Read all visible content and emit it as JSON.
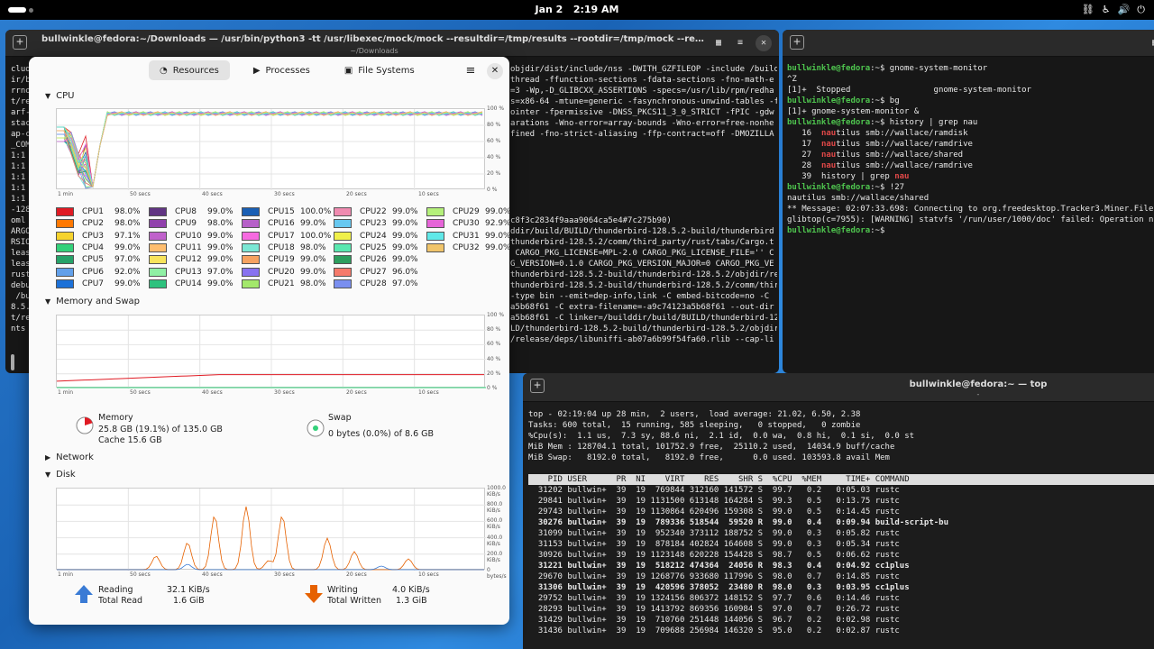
{
  "topbar": {
    "date": "Jan 2",
    "time": "2:19 AM"
  },
  "terminal_left": {
    "title": "bullwinkle@fedora:~/Downloads — /usr/bin/python3 -tt /usr/libexec/mock/mock --resultdir=/tmp/results --rootdir=/tmp/mock --rebuild thunderbird-128.5.2-1....",
    "subtitle": "~/Downloads",
    "left_lines": [
      "clud",
      "ir/b",
      "rrno",
      "t/re",
      "arf-",
      "stac",
      "ap-c",
      "_COM",
      "1:1",
      "1:1",
      "1:1",
      "1:1",
      "1:1",
      "-128",
      "oml",
      "ARGO",
      "RSIO",
      "leas",
      "leas",
      "rust",
      "debu",
      " /bu",
      "8.5.",
      "t/re",
      "nts"
    ],
    "right_lines": [
      "objdir/dist/include/nss -DWITH_GZFILEOP -include /buildd",
      "thread -ffunction-sections -fdata-sections -fno-math-e",
      "=3 -Wp,-D_GLIBCXX_ASSERTIONS -specs=/usr/lib/rpm/redha",
      "s=x86-64 -mtune=generic -fasynchronous-unwind-tables -f",
      "ointer -fpermissive -DNSS_PKCS11_3_0_STRICT -fPIC -gdw",
      "arations -Wno-error=array-bounds -Wno-error=free-nonhe",
      "fined -fno-strict-aliasing -ffp-contract=off -DMOZILLA",
      "",
      "",
      "",
      "",
      "",
      "",
      "",
      "c8f3c2834f9aaa9064ca5e4#7c275b90)",
      "ddir/build/BUILD/thunderbird-128.5.2-build/thunderbird",
      "thunderbird-128.5.2/comm/third_party/rust/tabs/Cargo.t",
      " CARGO_PKG_LICENSE=MPL-2.0 CARGO_PKG_LICENSE_FILE='' C",
      "G_VERSION=0.1.0 CARGO_PKG_VERSION_MAJOR=0 CARGO_PKG_VE",
      "thunderbird-128.5.2-build/thunderbird-128.5.2/objdir/re",
      "thunderbird-128.5.2-build/thunderbird-128.5.2/comm/third_party/",
      "-type bin --emit=dep-info,link -C embed-bitcode=no -C",
      "a5b68f61 -C extra-filename=-a9c74123a5b68f61 --out-dir",
      "a5b68f61 -C linker=/builddir/build/BUILD/thunderbird-12",
      "LD/thunderbird-128.5.2-build/thunderbird-128.5.2/objdir",
      "/release/deps/libuniffi-ab07a6b99f54fa60.rlib --cap-li"
    ]
  },
  "terminal_right": {
    "lines": [
      {
        "p": "bullwinkle@fedora",
        "t": ":~$ gnome-system-monitor"
      },
      {
        "t": "^Z"
      },
      {
        "t": "[1]+  Stopped                 gnome-system-monitor"
      },
      {
        "p": "bullwinkle@fedora",
        "t": ":~$ bg"
      },
      {
        "t": "[1]+ gnome-system-monitor &"
      },
      {
        "p": "bullwinkle@fedora",
        "t": ":~$ history | grep nau"
      },
      {
        "n": "   16  ",
        "r": "nau",
        "t": "tilus smb://wallace/ramdisk"
      },
      {
        "n": "   17  ",
        "r": "nau",
        "t": "tilus smb://wallace/ramdrive"
      },
      {
        "n": "   27  ",
        "r": "nau",
        "t": "tilus smb://wallace/shared"
      },
      {
        "n": "   28  ",
        "r": "nau",
        "t": "tilus smb://wallace/ramdrive"
      },
      {
        "n": "   39  ",
        "t": "history | grep ",
        "r2": "nau"
      },
      {
        "p": "bullwinkle@fedora",
        "t": ":~$ !27"
      },
      {
        "t": "nautilus smb://wallace/shared"
      },
      {
        "t": "** Message: 02:07:33.698: Connecting to org.freedesktop.Tracker3.Miner.Files"
      },
      {
        "t": "glibtop(c=7955): [WARNING] statvfs '/run/user/1000/doc' failed: Operation not"
      },
      {
        "p": "bullwinkle@fedora",
        "t": ":~$ "
      }
    ]
  },
  "top": {
    "title": "bullwinkle@fedora:~ — top",
    "summary": [
      "top - 02:19:04 up 28 min,  2 users,  load average: 21.02, 6.50, 2.38",
      "Tasks: 600 total,  15 running, 585 sleeping,   0 stopped,   0 zombie",
      "%Cpu(s):  1.1 us,  7.3 sy, 88.6 ni,  2.1 id,  0.0 wa,  0.8 hi,  0.1 si,  0.0 st",
      "MiB Mem : 128704.1 total, 101752.9 free,  25110.2 used,  14034.9 buff/cache",
      "MiB Swap:   8192.0 total,   8192.0 free,      0.0 used. 103593.8 avail Mem"
    ],
    "header": "    PID USER      PR  NI    VIRT    RES    SHR S  %CPU  %MEM     TIME+ COMMAND",
    "rows": [
      {
        "t": "  31202 bullwin+  39  19  769844 312160 141572 S  99.7   0.2   0:05.03 rustc",
        "b": false
      },
      {
        "t": "  29841 bullwin+  39  19 1131500 613148 164284 S  99.3   0.5   0:13.75 rustc",
        "b": false
      },
      {
        "t": "  29743 bullwin+  39  19 1130864 620496 159308 S  99.0   0.5   0:14.45 rustc",
        "b": false
      },
      {
        "t": "  30276 bullwin+  39  19  789336 518544  59520 R  99.0   0.4   0:09.94 build-script-bu",
        "b": true
      },
      {
        "t": "  31099 bullwin+  39  19  952340 373112 188752 S  99.0   0.3   0:05.82 rustc",
        "b": false
      },
      {
        "t": "  31153 bullwin+  39  19  878184 402824 164608 S  99.0   0.3   0:05.34 rustc",
        "b": false
      },
      {
        "t": "  30926 bullwin+  39  19 1123148 620228 154428 S  98.7   0.5   0:06.62 rustc",
        "b": false
      },
      {
        "t": "  31221 bullwin+  39  19  518212 474364  24056 R  98.3   0.4   0:04.92 cc1plus",
        "b": true
      },
      {
        "t": "  29670 bullwin+  39  19 1268776 933680 117996 S  98.0   0.7   0:14.85 rustc",
        "b": false
      },
      {
        "t": "  31306 bullwin+  39  19  420596 378052  23480 R  98.0   0.3   0:03.95 cc1plus",
        "b": true
      },
      {
        "t": "  29752 bullwin+  39  19 1324156 806372 148152 S  97.7   0.6   0:14.46 rustc",
        "b": false
      },
      {
        "t": "  28293 bullwin+  39  19 1413792 869356 160984 S  97.0   0.7   0:26.72 rustc",
        "b": false
      },
      {
        "t": "  31429 bullwin+  39  19  710760 251448 144056 S  96.7   0.2   0:02.98 rustc",
        "b": false
      },
      {
        "t": "  31436 bullwin+  39  19  709688 256984 146320 S  95.0   0.2   0:02.87 rustc",
        "b": false
      }
    ]
  },
  "sysmon": {
    "tabs": [
      "Resources",
      "Processes",
      "File Systems"
    ],
    "sections": {
      "cpu": "CPU",
      "mem": "Memory and Swap",
      "net": "Network",
      "disk": "Disk"
    },
    "time_labels": [
      "1 min",
      "50 secs",
      "40 secs",
      "30 secs",
      "20 secs",
      "10 secs"
    ],
    "pct_labels": [
      "100 %",
      "80 %",
      "60 %",
      "40 %",
      "20 %",
      "0 %"
    ],
    "disk_labels": [
      "1000.0 KiB/s",
      "800.0 KiB/s",
      "600.0 KiB/s",
      "400.0 KiB/s",
      "200.0 KiB/s",
      "0 bytes/s"
    ],
    "cpus": [
      {
        "n": "CPU1",
        "v": "98.0%",
        "c": "#e01b24"
      },
      {
        "n": "CPU2",
        "v": "98.0%",
        "c": "#ff7800"
      },
      {
        "n": "CPU3",
        "v": "97.1%",
        "c": "#f6d32d"
      },
      {
        "n": "CPU4",
        "v": "99.0%",
        "c": "#33d17a"
      },
      {
        "n": "CPU5",
        "v": "97.0%",
        "c": "#26a269"
      },
      {
        "n": "CPU6",
        "v": "92.0%",
        "c": "#62a0ea"
      },
      {
        "n": "CPU7",
        "v": "99.0%",
        "c": "#1c71d8"
      },
      {
        "n": "CPU8",
        "v": "99.0%",
        "c": "#613583"
      },
      {
        "n": "CPU9",
        "v": "98.0%",
        "c": "#9141ac"
      },
      {
        "n": "CPU10",
        "v": "99.0%",
        "c": "#c061cb"
      },
      {
        "n": "CPU11",
        "v": "99.0%",
        "c": "#ffbe6f"
      },
      {
        "n": "CPU12",
        "v": "99.0%",
        "c": "#f8e45c"
      },
      {
        "n": "CPU13",
        "v": "97.0%",
        "c": "#8ff0a4"
      },
      {
        "n": "CPU14",
        "v": "99.0%",
        "c": "#2ec27e"
      },
      {
        "n": "CPU15",
        "v": "100.0%",
        "c": "#1a5fb4"
      },
      {
        "n": "CPU16",
        "v": "99.0%",
        "c": "#b660c8"
      },
      {
        "n": "CPU17",
        "v": "100.0%",
        "c": "#f66ae0"
      },
      {
        "n": "CPU18",
        "v": "98.0%",
        "c": "#7be7d4"
      },
      {
        "n": "CPU19",
        "v": "99.0%",
        "c": "#f5a261"
      },
      {
        "n": "CPU20",
        "v": "99.0%",
        "c": "#8872f0"
      },
      {
        "n": "CPU21",
        "v": "98.0%",
        "c": "#a3e86b"
      },
      {
        "n": "CPU22",
        "v": "99.0%",
        "c": "#f08bb0"
      },
      {
        "n": "CPU23",
        "v": "99.0%",
        "c": "#67c8f0"
      },
      {
        "n": "CPU24",
        "v": "99.0%",
        "c": "#f0f04a"
      },
      {
        "n": "CPU25",
        "v": "99.0%",
        "c": "#5ae8b0"
      },
      {
        "n": "CPU26",
        "v": "99.0%",
        "c": "#2e9e5e"
      },
      {
        "n": "CPU27",
        "v": "96.0%",
        "c": "#f57a6a"
      },
      {
        "n": "CPU28",
        "v": "97.0%",
        "c": "#7a8ff0"
      },
      {
        "n": "CPU29",
        "v": "99.0%",
        "c": "#b4f07a"
      },
      {
        "n": "CPU30",
        "v": "92.9%",
        "c": "#e664d8"
      },
      {
        "n": "CPU31",
        "v": "99.0%",
        "c": "#60e8e8"
      },
      {
        "n": "CPU32",
        "v": "99.0%",
        "c": "#f0c46a"
      }
    ],
    "memory": {
      "label": "Memory",
      "value": "25.8 GB (19.1%) of 135.0 GB",
      "cache": "Cache 15.6 GB",
      "fraction": 0.191
    },
    "swap": {
      "label": "Swap",
      "value": "0 bytes (0.0%) of 8.6 GB",
      "fraction": 0.0
    },
    "disk": {
      "reading_label": "Reading",
      "reading": "32.1 KiB/s",
      "total_read_label": "Total Read",
      "total_read": "1.6 GiB",
      "writing_label": "Writing",
      "writing": "4.0 KiB/s",
      "total_written_label": "Total Written",
      "total_written": "1.3 GiB"
    }
  }
}
